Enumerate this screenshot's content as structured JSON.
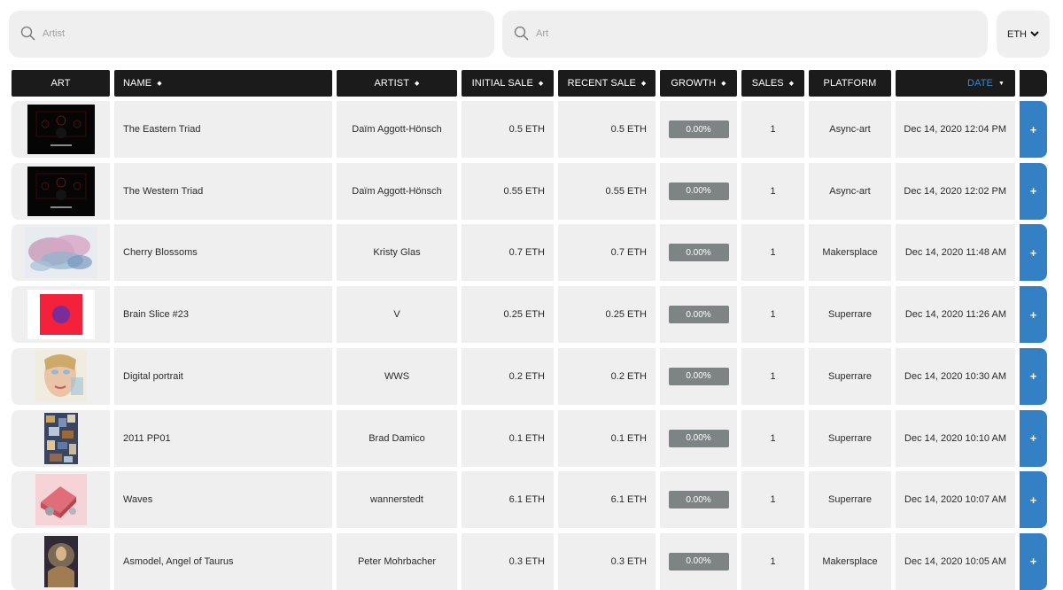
{
  "search": {
    "artist_placeholder": "Artist",
    "art_placeholder": "Art"
  },
  "currency": {
    "selected": "ETH"
  },
  "columns": {
    "art": "ART",
    "name": "NAME",
    "artist": "ARTIST",
    "initial_sale": "INITIAL SALE",
    "recent_sale": "RECENT SALE",
    "growth": "GROWTH",
    "sales": "SALES",
    "platform": "PLATFORM",
    "date": "DATE"
  },
  "colors": {
    "header_bg": "#1b1b1b",
    "row_bg": "#efefef",
    "accent": "#3381c4",
    "badge_bg": "#7e8484",
    "sort_active": "#3b86c8"
  },
  "row_action": "+",
  "rows": [
    {
      "name": "The Eastern Triad",
      "artist": "Daïm Aggott-Hönsch",
      "initial_sale": "0.5 ETH",
      "recent_sale": "0.5 ETH",
      "growth": "0.00%",
      "sales": "1",
      "platform": "Async-art",
      "date": "Dec 14, 2020 12:04 PM",
      "thumb": "black-triad-thumbnail"
    },
    {
      "name": "The Western Triad",
      "artist": "Daïm Aggott-Hönsch",
      "initial_sale": "0.55 ETH",
      "recent_sale": "0.55 ETH",
      "growth": "0.00%",
      "sales": "1",
      "platform": "Async-art",
      "date": "Dec 14, 2020 12:02 PM",
      "thumb": "black-triad-thumbnail"
    },
    {
      "name": "Cherry Blossoms",
      "artist": "Kristy Glas",
      "initial_sale": "0.7 ETH",
      "recent_sale": "0.7 ETH",
      "growth": "0.00%",
      "sales": "1",
      "platform": "Makersplace",
      "date": "Dec 14, 2020 11:48 AM",
      "thumb": "watercolor-blossom-thumbnail"
    },
    {
      "name": "Brain Slice #23",
      "artist": "V",
      "initial_sale": "0.25 ETH",
      "recent_sale": "0.25 ETH",
      "growth": "0.00%",
      "sales": "1",
      "platform": "Superrare",
      "date": "Dec 14, 2020 11:26 AM",
      "thumb": "red-square-purple-circle-thumbnail"
    },
    {
      "name": "Digital portrait",
      "artist": "WWS",
      "initial_sale": "0.2 ETH",
      "recent_sale": "0.2 ETH",
      "growth": "0.00%",
      "sales": "1",
      "platform": "Superrare",
      "date": "Dec 14, 2020 10:30 AM",
      "thumb": "portrait-face-thumbnail"
    },
    {
      "name": "2011 PP01",
      "artist": "Brad Damico",
      "initial_sale": "0.1 ETH",
      "recent_sale": "0.1 ETH",
      "growth": "0.00%",
      "sales": "1",
      "platform": "Superrare",
      "date": "Dec 14, 2020 10:10 AM",
      "thumb": "mosaic-collage-thumbnail"
    },
    {
      "name": "Waves",
      "artist": "wannerstedt",
      "initial_sale": "6.1 ETH",
      "recent_sale": "6.1 ETH",
      "growth": "0.00%",
      "sales": "1",
      "platform": "Superrare",
      "date": "Dec 14, 2020 10:07 AM",
      "thumb": "pink-waves-thumbnail"
    },
    {
      "name": "Asmodel, Angel of Taurus",
      "artist": "Peter Mohrbacher",
      "initial_sale": "0.3 ETH",
      "recent_sale": "0.3 ETH",
      "growth": "0.00%",
      "sales": "1",
      "platform": "Makersplace",
      "date": "Dec 14, 2020 10:05 AM",
      "thumb": "angel-painting-thumbnail"
    }
  ]
}
